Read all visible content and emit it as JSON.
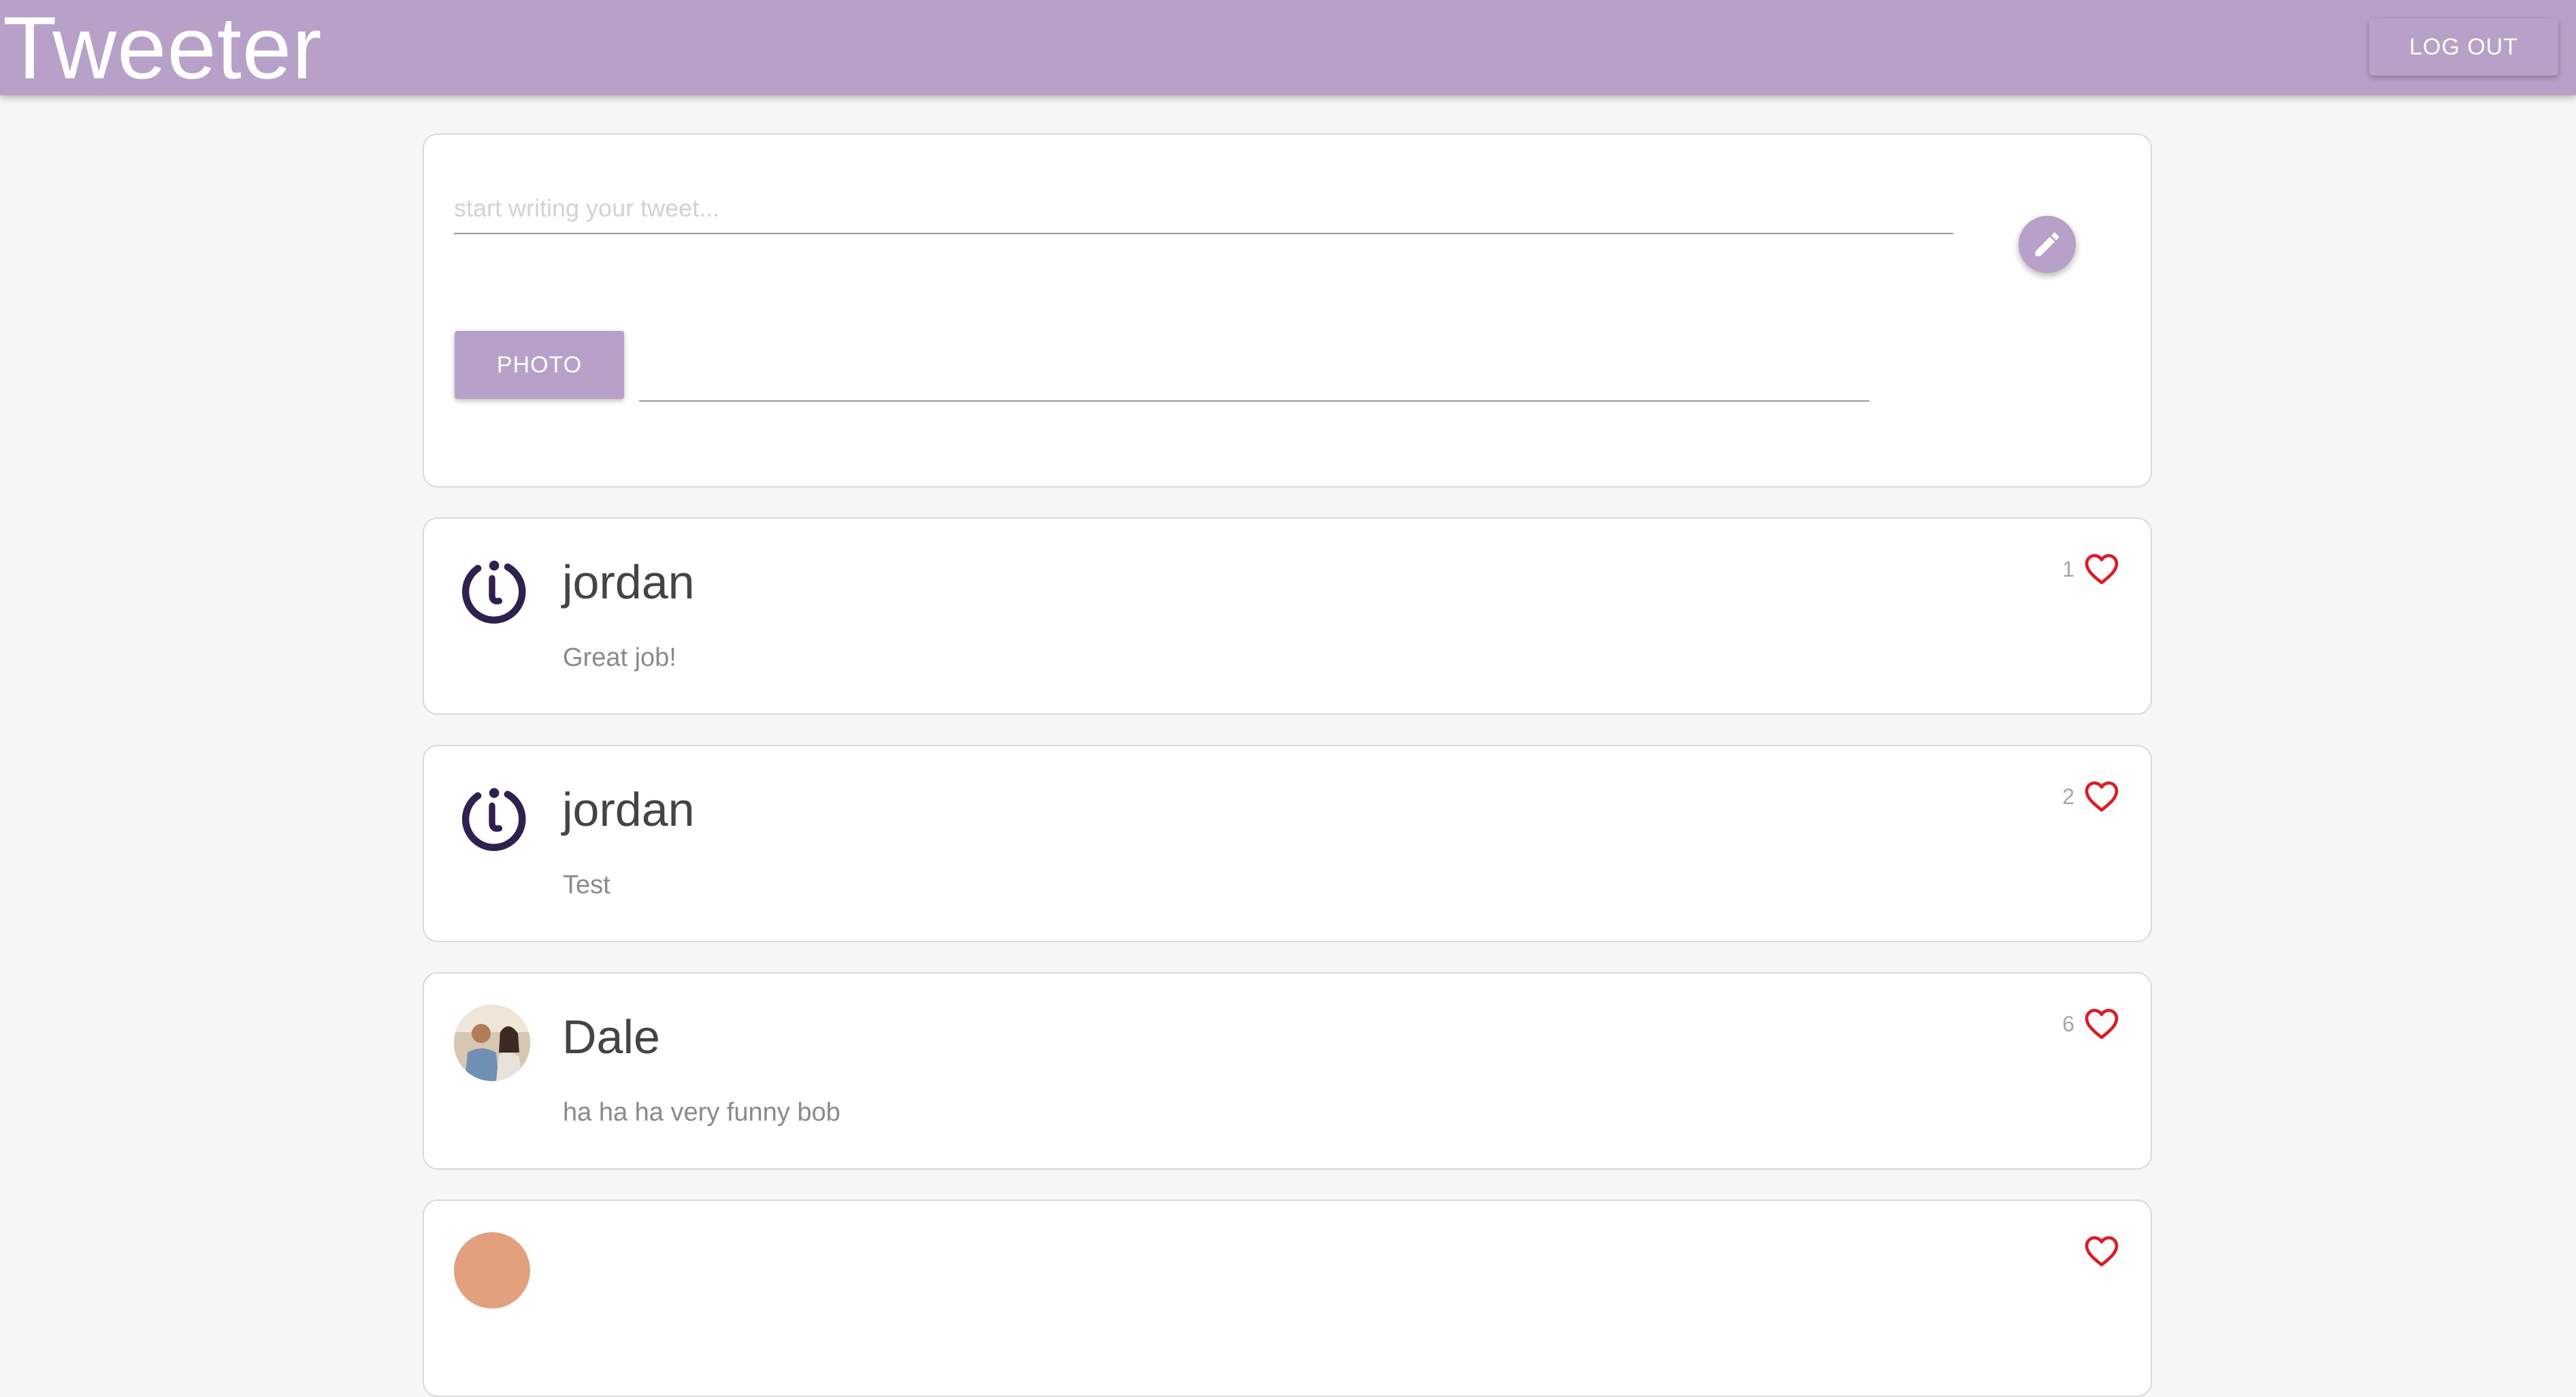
{
  "app": {
    "title": "Tweeter",
    "logout_label": "LOG OUT"
  },
  "composer": {
    "placeholder": "start writing your tweet...",
    "photo_label": "PHOTO",
    "post_icon": "pencil-icon"
  },
  "tweets": [
    {
      "user": "jordan",
      "text": "Great job!",
      "likes": "1",
      "avatar": "logo-avatar"
    },
    {
      "user": "jordan",
      "text": "Test",
      "likes": "2",
      "avatar": "logo-avatar"
    },
    {
      "user": "Dale",
      "text": "ha ha ha very funny bob",
      "likes": "6",
      "avatar": "photo-avatar"
    },
    {
      "user": "",
      "text": "",
      "likes": "",
      "avatar": "photo-avatar"
    }
  ],
  "colors": {
    "accent": "#b7a1c8",
    "heart": "#e8141e",
    "logo": "#2e2150",
    "background": "#f6f6f6"
  }
}
